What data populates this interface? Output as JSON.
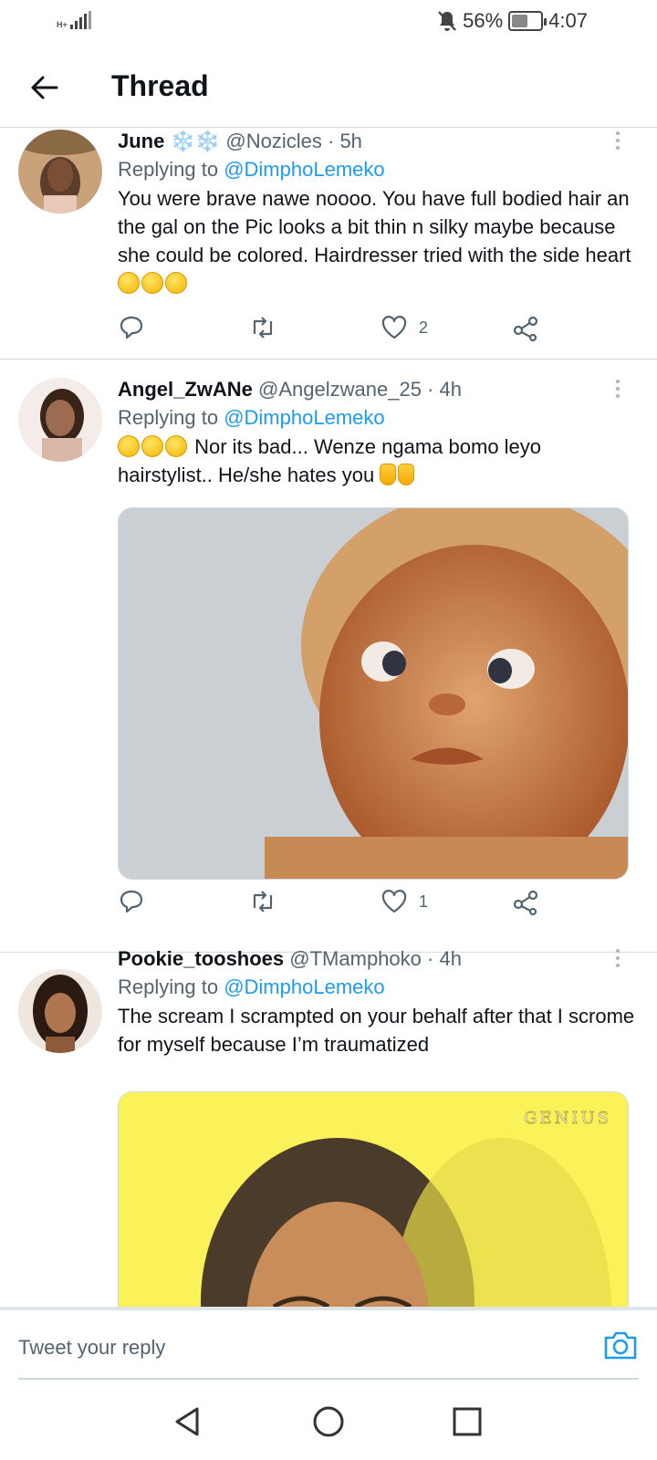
{
  "status_bar": {
    "network_type": "H+",
    "battery_percent": "56%",
    "time": "4:07",
    "battery_level": 0.56
  },
  "header": {
    "title": "Thread"
  },
  "tweets": [
    {
      "display_name": "June",
      "name_emoji": "❄️❄️",
      "handle": "@Nozicles",
      "time": "· 5h",
      "replying_prefix": "Replying to",
      "replying_to": "@DimphoLemeko",
      "text": "You were brave nawe noooo.  You have full bodied hair an the gal on the Pic looks a bit thin n silky maybe because she could be colored. Hairdresser tried with the side heart",
      "like_count": "2",
      "avatar_colors": [
        "#5a3e2b",
        "#c9a27a",
        "#2b1d14",
        "#e8c8b8"
      ]
    },
    {
      "display_name": "Angel_ZwANe",
      "handle": "@Angelzwane_25",
      "time": "· 4h",
      "replying_prefix": "Replying to",
      "replying_to": "@DimphoLemeko",
      "text": "Nor its bad... Wenze ngama bomo leyo hairstylist.. He/she hates you",
      "like_count": "1",
      "avatar_colors": [
        "#3a2418",
        "#d9b8a8",
        "#f3ece8"
      ],
      "media_description_colors": [
        "#c9cfd3",
        "#c78a55",
        "#b6652f",
        "#e0a470"
      ]
    },
    {
      "display_name": "Pookie_tooshoes",
      "handle": "@TMamphoko",
      "time": "· 4h",
      "replying_prefix": "Replying to",
      "replying_to": "@DimphoLemeko",
      "text": "The scream I scrampted on your behalf after that I scrome for myself because I’m traumatized",
      "media_watermark": "GENIUS",
      "avatar_colors": [
        "#2a1a12",
        "#b07650",
        "#f0e6e0"
      ],
      "media_colors": [
        "#fbf25a",
        "#4a3b2a",
        "#c98d5a"
      ]
    }
  ],
  "reply_bar": {
    "placeholder": "Tweet your reply"
  },
  "colors": {
    "accent": "#1d9bf0",
    "secondary_text": "#536471",
    "divider": "#cfd9de"
  },
  "icons": [
    "back-arrow-icon",
    "more-icon",
    "reply-icon",
    "retweet-icon",
    "like-icon",
    "share-icon",
    "camera-icon",
    "nav-back-icon",
    "nav-home-icon",
    "nav-recents-icon",
    "mute-icon",
    "battery-icon",
    "signal-icon"
  ]
}
